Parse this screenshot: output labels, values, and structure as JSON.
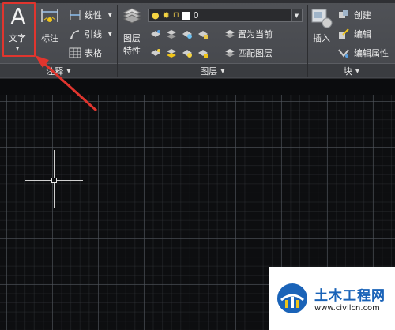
{
  "ribbon": {
    "annotation_panel": {
      "text_button": "文字",
      "dimension_button": "标注",
      "linear_button": "线性",
      "leader_button": "引线",
      "table_button": "表格",
      "panel_label": "注释"
    },
    "layers_panel": {
      "layer_properties_button": [
        "图层",
        "特性"
      ],
      "current_layer": "0",
      "make_current_button": "置为当前",
      "match_layer_button": "匹配图层",
      "panel_label": "图层"
    },
    "block_panel": {
      "insert_button": "插入",
      "create_button": "创建",
      "edit_button": "编辑",
      "edit_attributes_button": "编辑属性",
      "panel_label": "块"
    }
  },
  "watermark": {
    "title": "土木工程网",
    "url": "www.civilcn.com"
  },
  "colors": {
    "ribbon_bg": "#4b4d52",
    "canvas_bg": "#0d0e10",
    "highlight": "#e0352e",
    "arrow": "#e0352e",
    "watermark_blue": "#1a63b8"
  }
}
